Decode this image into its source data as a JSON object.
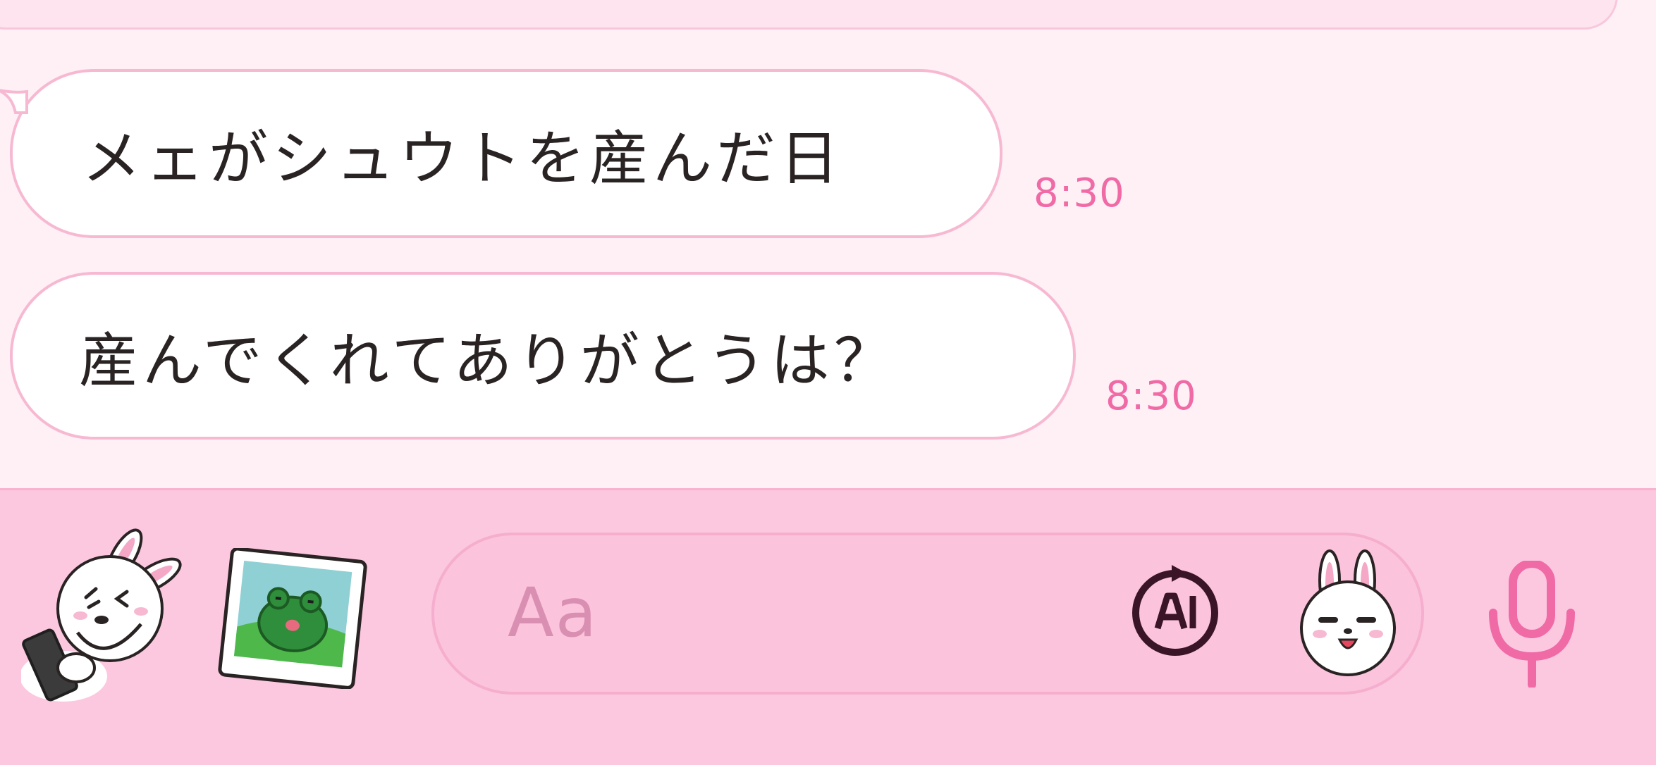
{
  "messages": [
    {
      "text": "メェがシュウトを産んだ日",
      "time": "8:30"
    },
    {
      "text": "産んでくれてありがとうは？",
      "time": "8:30"
    }
  ],
  "input": {
    "placeholder": "Aa",
    "buttons": [
      "sticker-icon",
      "photo-icon",
      "ai-icon",
      "emoji-icon",
      "microphone-icon"
    ]
  },
  "colors": {
    "chat_background": "#fff0f6",
    "bubble_border": "#f7b9d2",
    "timestamp": "#f06aa6",
    "input_bar": "#fcc8df",
    "mic": "#f06aa6"
  }
}
